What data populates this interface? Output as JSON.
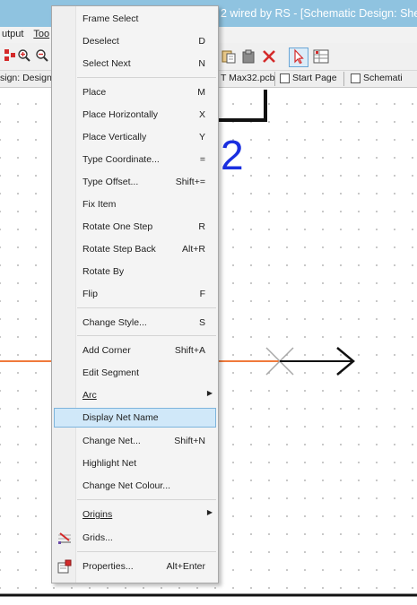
{
  "window": {
    "title": "2 wired by RS - [Schematic Design: She"
  },
  "menubar": {
    "items": [
      {
        "label": "utput",
        "underline": ""
      },
      {
        "label": "Too",
        "underline": "T"
      }
    ]
  },
  "tabs": [
    {
      "label": "sign: Design"
    },
    {
      "label": "T Max32.pcb"
    },
    {
      "label": "Start Page"
    },
    {
      "label": "Schemati"
    }
  ],
  "canvas": {
    "annotation": "2",
    "colors": {
      "orange_wire": "#f07a3c",
      "black_wire": "#111111",
      "grey_cross": "#a8a8a8",
      "annotation_blue": "#1a2fe0"
    }
  },
  "context_menu": {
    "highlight_color": "#d0e8f9",
    "items": [
      {
        "label": "Frame Select",
        "shortcut": ""
      },
      {
        "label": "Deselect",
        "shortcut": "D"
      },
      {
        "label": "Select Next",
        "shortcut": "N"
      },
      {
        "label": "Place",
        "shortcut": "M"
      },
      {
        "label": "Place Horizontally",
        "shortcut": "X"
      },
      {
        "label": "Place Vertically",
        "shortcut": "Y"
      },
      {
        "label": "Type Coordinate...",
        "shortcut": "="
      },
      {
        "label": "Type Offset...",
        "shortcut": "Shift+="
      },
      {
        "label": "Fix Item",
        "shortcut": ""
      },
      {
        "label": "Rotate One Step",
        "shortcut": "R"
      },
      {
        "label": "Rotate Step Back",
        "shortcut": "Alt+R"
      },
      {
        "label": "Rotate By",
        "shortcut": ""
      },
      {
        "label": "Flip",
        "shortcut": "F"
      },
      {
        "label": "Change Style...",
        "shortcut": "S"
      },
      {
        "label": "Add Corner",
        "shortcut": "Shift+A"
      },
      {
        "label": "Edit Segment",
        "shortcut": ""
      },
      {
        "label": "Arc",
        "shortcut": "",
        "submenu": true
      },
      {
        "label": "Display Net Name",
        "shortcut": "",
        "highlighted": true
      },
      {
        "label": "Change Net...",
        "shortcut": "Shift+N"
      },
      {
        "label": "Highlight Net",
        "shortcut": ""
      },
      {
        "label": "Change Net Colour...",
        "shortcut": ""
      },
      {
        "label": "Origins",
        "shortcut": "",
        "submenu": true
      },
      {
        "label": "Grids...",
        "shortcut": "",
        "icon": "grid-icon"
      },
      {
        "label": "Properties...",
        "shortcut": "Alt+Enter",
        "icon": "properties-icon"
      }
    ]
  }
}
